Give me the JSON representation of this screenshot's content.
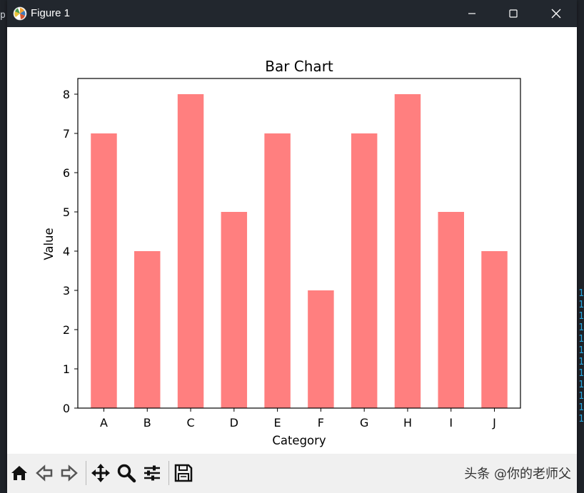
{
  "window": {
    "title": "Figure 1"
  },
  "background": {
    "left_fragment": "p",
    "right_digits": [
      "1",
      "1",
      "1",
      "1",
      "1",
      "1",
      "1",
      "1",
      "1",
      "1",
      "1",
      "1"
    ]
  },
  "toolbar": {
    "watermark": "头条 @你的老师父"
  },
  "colors": {
    "bar": "#ff7f7f",
    "titlebar": "#22272e",
    "toolbar": "#f0f0f0"
  },
  "chart_data": {
    "type": "bar",
    "title": "Bar Chart",
    "xlabel": "Category",
    "ylabel": "Value",
    "categories": [
      "A",
      "B",
      "C",
      "D",
      "E",
      "F",
      "G",
      "H",
      "I",
      "J"
    ],
    "values": [
      7,
      4,
      8,
      5,
      7,
      3,
      7,
      8,
      5,
      4
    ],
    "ylim": [
      0,
      8.4
    ],
    "yticks": [
      0,
      1,
      2,
      3,
      4,
      5,
      6,
      7,
      8
    ],
    "grid": false
  }
}
